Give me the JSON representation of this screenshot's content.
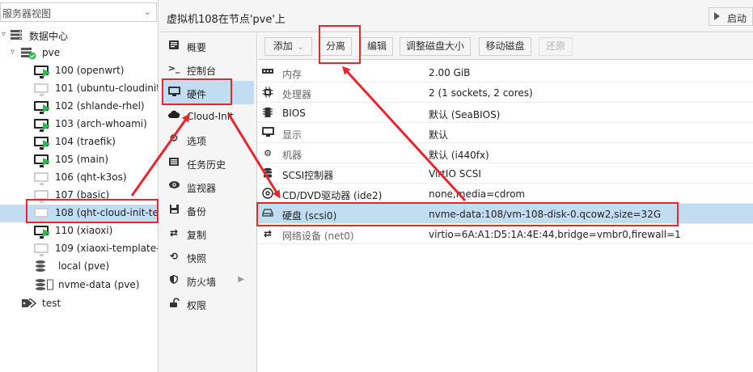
{
  "tree": {
    "view_selector": "服务器视图",
    "datacenter": "数据中心",
    "node": "pve",
    "vms": [
      {
        "label": "100 (openwrt)",
        "running": true
      },
      {
        "label": "101 (ubuntu-cloudinit)",
        "running": false
      },
      {
        "label": "102 (shlande-rhel)",
        "running": true
      },
      {
        "label": "103 (arch-whoami)",
        "running": true
      },
      {
        "label": "104 (traefik)",
        "running": true
      },
      {
        "label": "105 (main)",
        "running": true
      },
      {
        "label": "106 (qht-k3os)",
        "running": false
      },
      {
        "label": "107 (basic)",
        "running": false
      },
      {
        "label": "108 (qht-cloud-init-tes",
        "running": false,
        "selected": true
      },
      {
        "label": "110 (xiaoxi)",
        "running": true
      },
      {
        "label": "109 (xiaoxi-template-t",
        "running": false
      }
    ],
    "storages": [
      "local (pve)",
      "nvme-data (pve)"
    ],
    "tag": "test"
  },
  "header": {
    "title": "虚拟机108在节点'pve'上",
    "start_label": "启动"
  },
  "nav": {
    "items": [
      {
        "label": "概要",
        "icon": "book-icon"
      },
      {
        "label": "控制台",
        "icon": "terminal-icon"
      },
      {
        "label": "硬件",
        "icon": "monitor-icon",
        "selected": true
      },
      {
        "label": "Cloud-Init",
        "icon": "cloud-icon"
      },
      {
        "label": "选项",
        "icon": "gear-icon"
      },
      {
        "label": "任务历史",
        "icon": "list-icon"
      },
      {
        "label": "监视器",
        "icon": "eye-icon"
      },
      {
        "label": "备份",
        "icon": "floppy-icon"
      },
      {
        "label": "复制",
        "icon": "retweet-icon"
      },
      {
        "label": "快照",
        "icon": "history-icon"
      },
      {
        "label": "防火墙",
        "icon": "shield-icon",
        "has_submenu": true
      },
      {
        "label": "权限",
        "icon": "unlock-icon"
      }
    ]
  },
  "toolbar": {
    "add_label": "添加",
    "detach_label": "分离",
    "edit_label": "编辑",
    "resize_label": "调整磁盘大小",
    "move_label": "移动磁盘",
    "revert_label": "还原"
  },
  "hardware": {
    "rows": [
      {
        "key": "内存",
        "value": "2.00 GiB",
        "icon": "memory-icon",
        "dim": true
      },
      {
        "key": "处理器",
        "value": "2 (1 sockets, 2 cores)",
        "icon": "cpu-icon",
        "dim": true
      },
      {
        "key": "BIOS",
        "value": "默认 (SeaBIOS)",
        "icon": "microchip-icon",
        "dim": false
      },
      {
        "key": "显示",
        "value": "默认",
        "icon": "desktop-icon",
        "dim": true
      },
      {
        "key": "机器",
        "value": "默认 (i440fx)",
        "icon": "cogs-icon",
        "dim": true
      },
      {
        "key": "SCSI控制器",
        "value": "VirtIO SCSI",
        "icon": "database-icon",
        "dim": false
      },
      {
        "key": "CD/DVD驱动器 (ide2)",
        "value": "none,media=cdrom",
        "icon": "cdrom-icon",
        "dim": false
      },
      {
        "key": "硬盘 (scsi0)",
        "value": "nvme-data:108/vm-108-disk-0.qcow2,size=32G",
        "icon": "hdd-icon",
        "dim": false,
        "selected": true
      },
      {
        "key": "网络设备 (net0)",
        "value": "virtio=6A:A1:D5:1A:4E:44,bridge=vmbr0,firewall=1",
        "icon": "exchange-icon",
        "dim": true
      }
    ]
  },
  "colors": {
    "selection": "#c2dcf2",
    "annotation": "#e8262c",
    "running": "#21bf4b"
  }
}
